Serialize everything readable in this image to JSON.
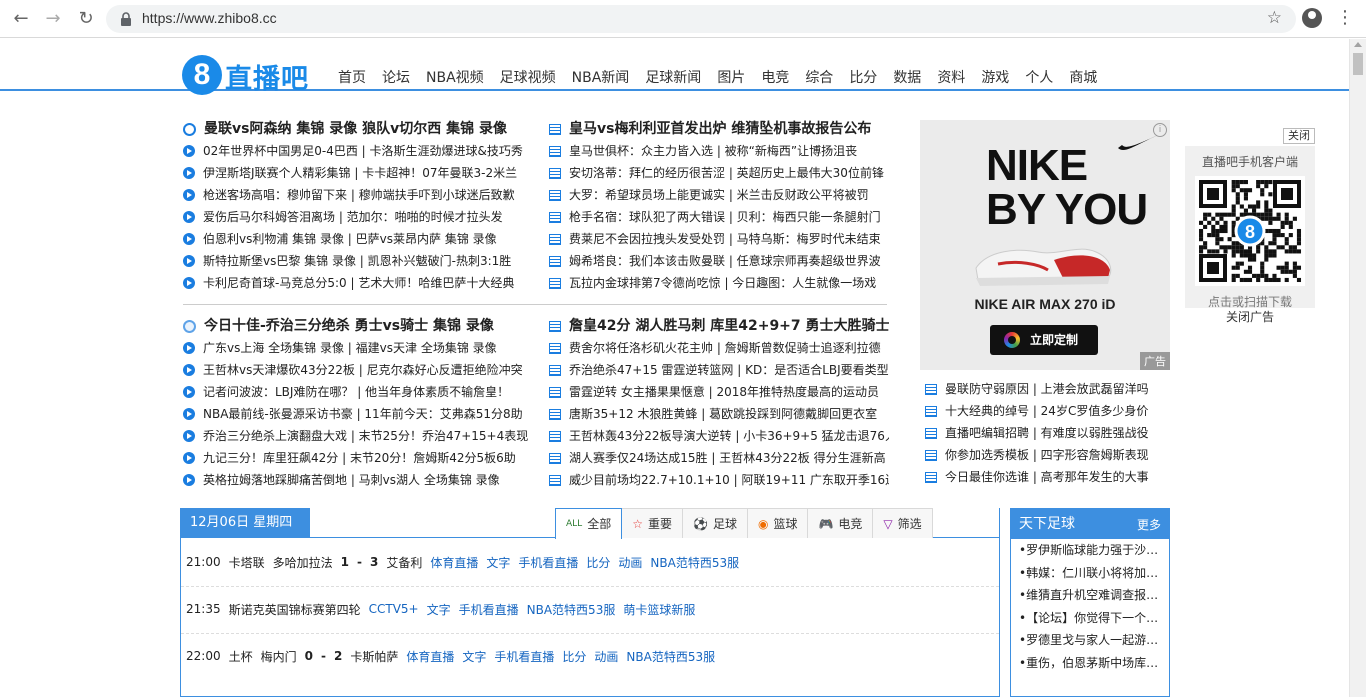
{
  "browser": {
    "url": "https://www.zhibo8.cc"
  },
  "site": {
    "logo_text": "直播吧",
    "nav": [
      "首页",
      "论坛",
      "NBA视频",
      "足球视频",
      "NBA新闻",
      "足球新闻",
      "图片",
      "电竞",
      "综合",
      "比分",
      "数据",
      "资料",
      "游戏",
      "个人",
      "商城"
    ]
  },
  "football_video": {
    "title": "曼联vs阿森纳 集锦 录像  狼队v切尔西 集锦 录像",
    "items": [
      "02年世界杯中国男足0-4巴西 | 卡洛斯生涯劲爆进球&技巧秀",
      "伊涅斯塔J联赛个人精彩集锦 | 卡卡超神！07年曼联3-2米兰",
      "枪迷客场高唱：穆帅留下来 | 穆帅端扶手吓到小球迷后致歉",
      "爱伤后马尔科姆答泪离场 | 范加尔：啪啪的时候才拉头发",
      "伯恩利vs利物浦 集锦 录像 | 巴萨vs莱昂内萨 集锦 录像",
      "斯特拉斯堡vs巴黎 集锦 录像 | 凯恩补兴魃破门-热刺3:1胜",
      "卡利尼奇首球-马竞总分5:0 | 艺术大师！哈维巴萨十大经典"
    ]
  },
  "football_news": {
    "title": "皇马vs梅利利亚首发出炉  维猜坠机事故报告公布",
    "items": [
      "皇马世俱杯：众主力皆入选 | 被称“新梅西”让博扬沮丧",
      "安切洛蒂：拜仁的经历很苦涩 | 英超历史上最伟大30位前锋",
      "大罗：希望球员场上能更诚实 | 米兰击反财政公平将被罚",
      "枪手名宿：球队犯了两大错误 | 贝利：梅西只能一条腿射门",
      "费莱尼不会因拉拽头发受处罚 | 马特乌斯：梅罗时代未结束",
      "姆希塔良：我们本该击败曼联 | 任意球宗师再奏超级世界波",
      "瓦拉内金球排第7令德尚吃惊 | 今日趣图：人生就像一场戏"
    ]
  },
  "nba_video": {
    "title": "今日十佳-乔治三分绝杀  勇士vs骑士 集锦 录像",
    "items": [
      "广东vs上海 全场集锦 录像 | 福建vs天津 全场集锦 录像",
      "王哲林vs天津爆砍43分22板 | 尼克尔森好心反遭拒绝险冲突",
      "记者问波波：LBJ难防在哪？ | 他当年身体素质不输詹皇！",
      "NBA最前线-张曼源采访书豪 | 11年前今天：艾弗森51分8助",
      "乔治三分绝杀上演翻盘大戏 | 末节25分！乔治47+15+4表现",
      "九记三分！库里狂飙42分 | 末节20分！詹姆斯42分5板6助",
      "英格拉姆落地踩脚痛苦倒地 | 马刺vs湖人 全场集锦 录像"
    ]
  },
  "nba_news": {
    "title": "詹皇42分 湖人胜马刺  库里42+9+7 勇士大胜骑士",
    "items": [
      "费舍尔将任洛杉矶火花主帅 | 詹姆斯曾数促骑士追逐利拉德",
      "乔治绝杀47+15 雷霆逆转篮网 | KD：是否适合LBJ要看类型",
      "雷霆逆转 女主播果果惬意 | 2018年推特热度最高的运动员",
      "唐斯35+12 木狼胜黄蜂 | 葛欧跳投踩到阿德戴脚回更衣室",
      "王哲林轰43分22板导演大逆转 | 小卡36+9+5 猛龙击退76人",
      "湖人赛季仅24场达成15胜 | 王哲林43分22板 得分生涯新高",
      "威少目前场均22.7+10.1+10 | 阿联19+11 广东取开季16连胜"
    ]
  },
  "ad": {
    "line1": "NIKE",
    "line2": "BY YOU",
    "model": "NIKE AIR MAX 270 iD",
    "cta": "立即定制",
    "tag": "广告"
  },
  "side_news": [
    "曼联防守弱原因 | 上港会放武磊留洋吗",
    "十大经典的绰号 | 24岁C罗值多少身价",
    "直播吧编辑招聘 | 有难度以弱胜强战役",
    "你参加选秀模板 | 四字形容詹姆斯表现",
    "今日最佳你选谁 | 高考那年发生的大事"
  ],
  "qr": {
    "close_top": "关闭",
    "title": "直播吧手机客户端",
    "bottom": "点击或扫描下载",
    "close_ad": "关闭广告"
  },
  "schedule": {
    "date": "12月06日 星期四",
    "filters": [
      {
        "icon": "ALL",
        "label": "全部",
        "color": "#2e7d32"
      },
      {
        "icon": "☆",
        "label": "重要",
        "color": "#e53935"
      },
      {
        "icon": "⚽",
        "label": "足球",
        "color": "#1565c0"
      },
      {
        "icon": "◉",
        "label": "篮球",
        "color": "#ef6c00"
      },
      {
        "icon": "🎮",
        "label": "电竞",
        "color": "#1565c0"
      },
      {
        "icon": "▽",
        "label": "筛选",
        "color": "#8e24aa"
      }
    ],
    "rows": [
      {
        "time": "21:00",
        "league": "卡塔联",
        "home": "多哈加拉法",
        "s1": "1",
        "dash": "-",
        "s2": "3",
        "away": "艾备利",
        "links": [
          "体育直播",
          "文字",
          "手机看直播",
          "比分",
          "动画",
          "NBA范特西53服"
        ]
      },
      {
        "time": "21:35",
        "league": "斯诺克英国锦标赛第四轮",
        "links": [
          "CCTV5+",
          "文字",
          "手机看直播",
          "NBA范特西53服",
          "萌卡篮球新服"
        ]
      },
      {
        "time": "22:00",
        "league": "土杯",
        "home": "梅内门",
        "s1": "0",
        "dash": "-",
        "s2": "2",
        "away": "卡斯帕萨",
        "links": [
          "体育直播",
          "文字",
          "手机看直播",
          "比分",
          "动画",
          "NBA范特西53服"
        ]
      }
    ]
  },
  "world_football": {
    "title": "天下足球",
    "more": "更多",
    "items": [
      "•罗伊斯临球能力强于沙尔…",
      "•韩媒：仁川联小将将加盟…",
      "•维猜直升机空难调查报告…",
      "•【论坛】你觉得下一个获…",
      "•罗德里戈与家人一起游玩…",
      "•重伤，伯恩茅斯中场库克…"
    ]
  },
  "colors": {
    "brand": "#1a8ae8",
    "accent": "#3d8fe0",
    "link": "#1565c0"
  }
}
